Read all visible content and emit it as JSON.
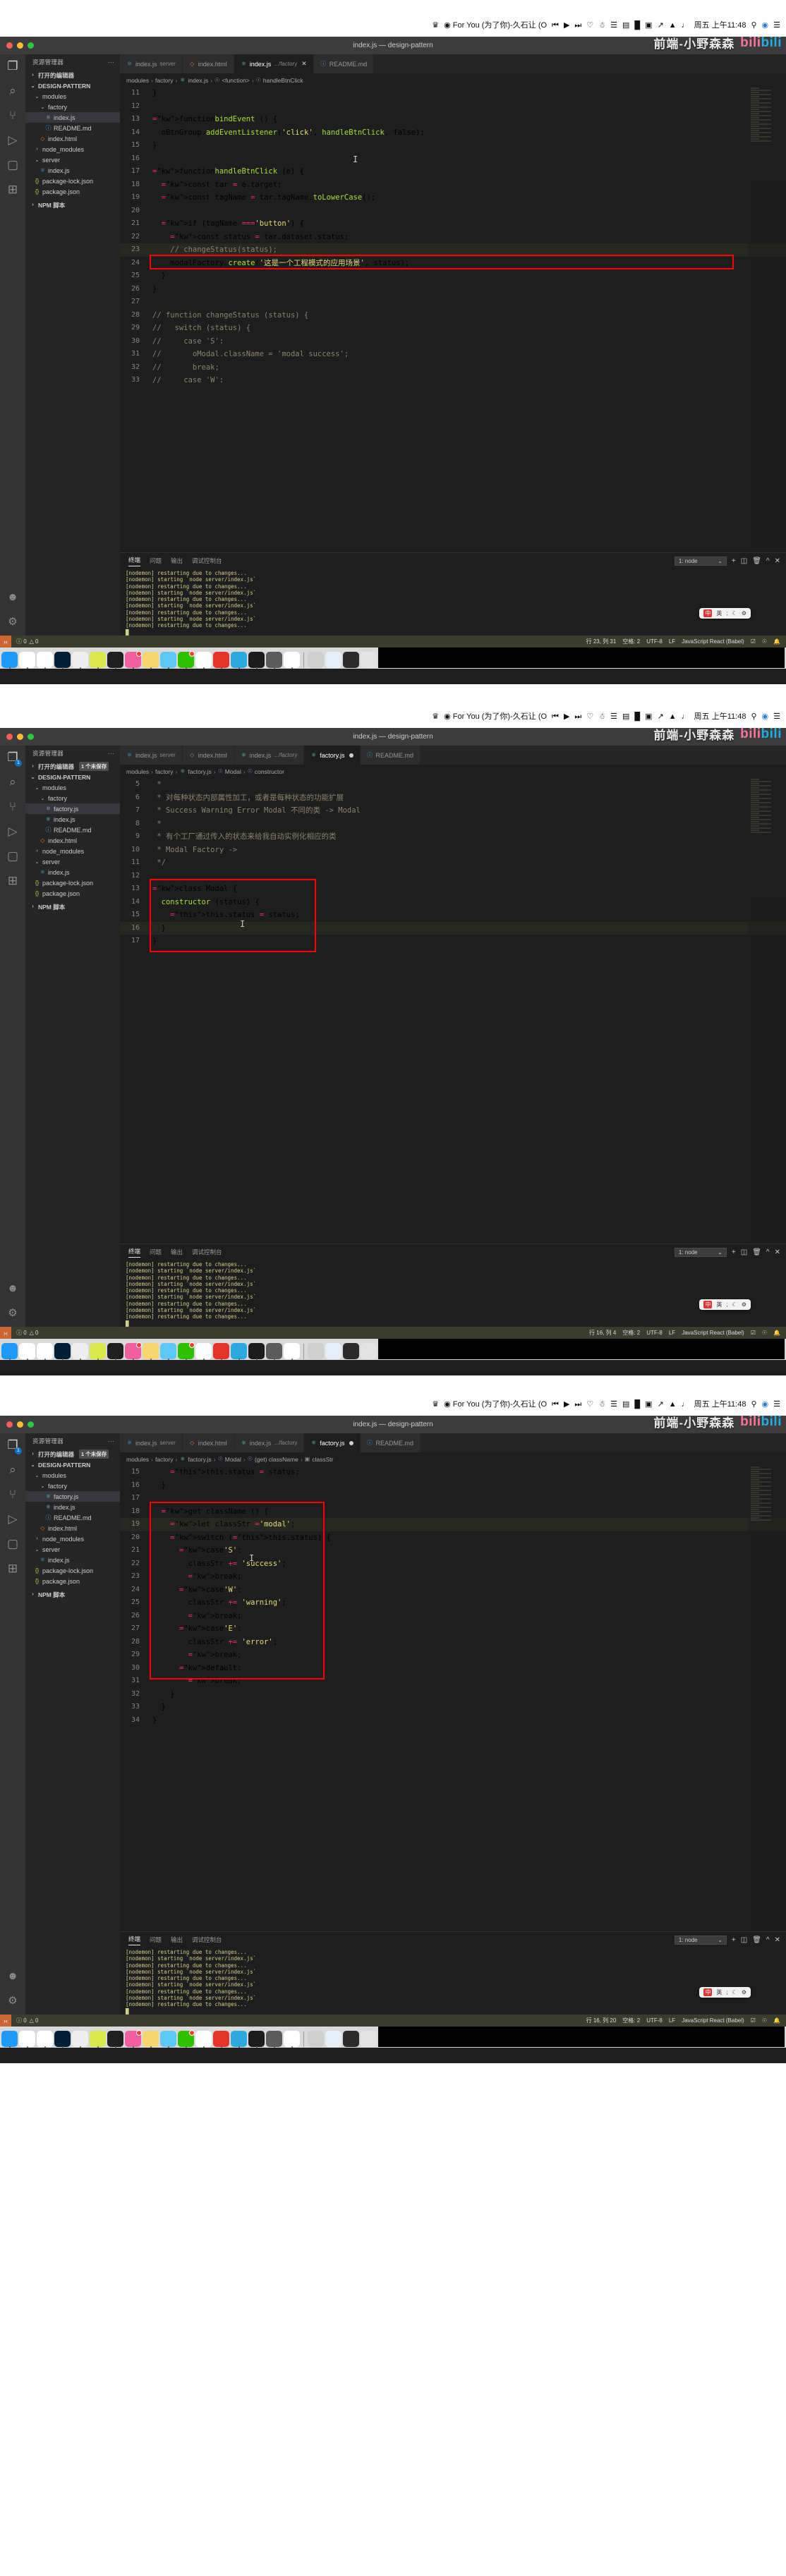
{
  "macbar": {
    "music_label": "For You (为了你)-久石让 (O",
    "time": "周五 上午11:48",
    "icons": [
      "bluetooth-icon",
      "appradio-icon",
      "prev-icon",
      "play-icon",
      "next-icon",
      "heart-icon",
      "user-icon",
      "keyboard-icon",
      "colorpicker-icon",
      "record-icon",
      "screen-icon",
      "wifi-icon",
      "battery-icon",
      "volume-icon",
      "spotlight-icon",
      "control-center-icon",
      "list-icon"
    ]
  },
  "watermark": {
    "text": "前端-小野森森",
    "brand_a": "bili",
    "brand_b": "bili"
  },
  "window": {
    "title": "index.js — design-pattern"
  },
  "activity_bar": {
    "items": [
      {
        "name": "explorer-icon",
        "glyph": "❐",
        "active": true
      },
      {
        "name": "search-icon",
        "glyph": "⌕",
        "active": false
      },
      {
        "name": "source-control-icon",
        "glyph": "⑂",
        "active": false
      },
      {
        "name": "run-debug-icon",
        "glyph": "▷",
        "active": false
      },
      {
        "name": "remote-explorer-icon",
        "glyph": "▢",
        "active": false
      },
      {
        "name": "extensions-icon",
        "glyph": "⊞",
        "active": false
      }
    ],
    "bottom": [
      {
        "name": "account-icon",
        "glyph": "☻"
      },
      {
        "name": "settings-gear-icon",
        "glyph": "⚙"
      }
    ]
  },
  "sidebar": {
    "title": "资源管理器",
    "more_label": "···",
    "open_editors_label": "打开的编辑器",
    "unsaved_badge": "1 个未保存",
    "project_label": "DESIGN-PATTERN",
    "npm_scripts_label": "NPM 脚本",
    "tree_shot1": [
      {
        "label": "modules",
        "type": "folder",
        "depth": 1,
        "open": true
      },
      {
        "label": "factory",
        "type": "folder",
        "depth": 2,
        "open": true
      },
      {
        "label": "index.js",
        "type": "jsx",
        "depth": 3,
        "selected": true
      },
      {
        "label": "README.md",
        "type": "md",
        "depth": 3
      },
      {
        "label": "index.html",
        "type": "html",
        "depth": 2
      },
      {
        "label": "node_modules",
        "type": "folder",
        "depth": 1,
        "open": false
      },
      {
        "label": "server",
        "type": "folder",
        "depth": 1,
        "open": true
      },
      {
        "label": "index.js",
        "type": "js",
        "depth": 2
      },
      {
        "label": "package-lock.json",
        "type": "json",
        "depth": 1
      },
      {
        "label": "package.json",
        "type": "json",
        "depth": 1
      }
    ],
    "tree_shot23": [
      {
        "label": "modules",
        "type": "folder",
        "depth": 1,
        "open": true
      },
      {
        "label": "factory",
        "type": "folder",
        "depth": 2,
        "open": true
      },
      {
        "label": "factory.js",
        "type": "jsx",
        "depth": 3,
        "selected": true
      },
      {
        "label": "index.js",
        "type": "jsx",
        "depth": 3
      },
      {
        "label": "README.md",
        "type": "md",
        "depth": 3
      },
      {
        "label": "index.html",
        "type": "html",
        "depth": 2
      },
      {
        "label": "node_modules",
        "type": "folder",
        "depth": 1,
        "open": false
      },
      {
        "label": "server",
        "type": "folder",
        "depth": 1,
        "open": true
      },
      {
        "label": "index.js",
        "type": "js",
        "depth": 2
      },
      {
        "label": "package-lock.json",
        "type": "json",
        "depth": 1
      },
      {
        "label": "package.json",
        "type": "json",
        "depth": 1
      }
    ]
  },
  "tabs_shot1": [
    {
      "label": "index.js",
      "sub": "server",
      "type": "js",
      "active": false,
      "close": false,
      "dirty": false
    },
    {
      "label": "index.html",
      "sub": "",
      "type": "html",
      "active": false,
      "close": false,
      "dirty": false
    },
    {
      "label": "index.js",
      "sub": ".../factory",
      "type": "jsx",
      "active": true,
      "close": true,
      "dirty": false
    },
    {
      "label": "README.md",
      "sub": "",
      "type": "md",
      "active": false,
      "close": false,
      "dirty": false
    }
  ],
  "tabs_shot2": [
    {
      "label": "index.js",
      "sub": "server",
      "type": "js",
      "active": false,
      "close": false,
      "dirty": false
    },
    {
      "label": "index.html",
      "sub": "",
      "type": "html",
      "active": false,
      "close": false,
      "dirty": false
    },
    {
      "label": "index.js",
      "sub": ".../factory",
      "type": "jsx",
      "active": false,
      "close": false,
      "dirty": false
    },
    {
      "label": "factory.js",
      "sub": "",
      "type": "jsx",
      "active": true,
      "close": false,
      "dirty": true
    },
    {
      "label": "README.md",
      "sub": "",
      "type": "md",
      "active": false,
      "close": false,
      "dirty": false
    }
  ],
  "breadcrumb_shot1": [
    "modules",
    "factory",
    "index.js",
    "<function>",
    "handleBtnClick"
  ],
  "breadcrumb_shot2": [
    "modules",
    "factory",
    "factory.js",
    "Modal",
    "constructor"
  ],
  "breadcrumb_shot3": [
    "modules",
    "factory",
    "factory.js",
    "Modal",
    "(get) className",
    "classStr"
  ],
  "code_shot1": [
    {
      "n": 11,
      "t": "}"
    },
    {
      "n": 12,
      "t": ""
    },
    {
      "n": 13,
      "t": "function bindEvent () {"
    },
    {
      "n": 14,
      "t": "  oBtnGroup.addEventListener('click', handleBtnClick, false);"
    },
    {
      "n": 15,
      "t": "}"
    },
    {
      "n": 16,
      "t": ""
    },
    {
      "n": 17,
      "t": "function handleBtnClick (e) {"
    },
    {
      "n": 18,
      "t": "  const tar = e.target;"
    },
    {
      "n": 19,
      "t": "  const tagName = tar.tagName.toLowerCase();"
    },
    {
      "n": 20,
      "t": ""
    },
    {
      "n": 21,
      "t": "  if (tagName === 'button') {"
    },
    {
      "n": 22,
      "t": "    const status = tar.dataset.status;"
    },
    {
      "n": 23,
      "t": "    // changeStatus(status);"
    },
    {
      "n": 24,
      "t": "    modalFactory.create('这是一个工程模式的应用场景', status);"
    },
    {
      "n": 25,
      "t": "  }"
    },
    {
      "n": 26,
      "t": "}"
    },
    {
      "n": 27,
      "t": ""
    },
    {
      "n": 28,
      "t": "// function changeStatus (status) {"
    },
    {
      "n": 29,
      "t": "//   switch (status) {"
    },
    {
      "n": 30,
      "t": "//     case 'S':"
    },
    {
      "n": 31,
      "t": "//       oModal.className = 'modal success';"
    },
    {
      "n": 32,
      "t": "//       break;"
    },
    {
      "n": 33,
      "t": "//     case 'W':"
    }
  ],
  "code_shot2": [
    {
      "n": 5,
      "t": " *"
    },
    {
      "n": 6,
      "t": " * 对每种状态内部属性加工，或者是每种状态的功能扩展"
    },
    {
      "n": 7,
      "t": " * Success Warning Error Modal 不同的类 -> Modal"
    },
    {
      "n": 8,
      "t": " *"
    },
    {
      "n": 9,
      "t": " * 有个工厂通过传入的状态来给我自动实例化相应的类"
    },
    {
      "n": 10,
      "t": " * Modal Factory ->"
    },
    {
      "n": 11,
      "t": " */"
    },
    {
      "n": 12,
      "t": ""
    },
    {
      "n": 13,
      "t": "class Modal {"
    },
    {
      "n": 14,
      "t": "  constructor (status) {"
    },
    {
      "n": 15,
      "t": "    this.status = status;"
    },
    {
      "n": 16,
      "t": "  }"
    },
    {
      "n": 17,
      "t": "}"
    }
  ],
  "code_shot3": [
    {
      "n": 15,
      "t": "    this.status = status;"
    },
    {
      "n": 16,
      "t": "  }"
    },
    {
      "n": 17,
      "t": ""
    },
    {
      "n": 18,
      "t": "  get className () {"
    },
    {
      "n": 19,
      "t": "    let classStr = 'modal';"
    },
    {
      "n": 20,
      "t": "    switch (this.status) {"
    },
    {
      "n": 21,
      "t": "      case 'S':"
    },
    {
      "n": 22,
      "t": "        classStr += 'success';"
    },
    {
      "n": 23,
      "t": "        break;"
    },
    {
      "n": 24,
      "t": "      case 'W':"
    },
    {
      "n": 25,
      "t": "        classStr += 'warning';"
    },
    {
      "n": 26,
      "t": "        break;"
    },
    {
      "n": 27,
      "t": "      case 'E':"
    },
    {
      "n": 28,
      "t": "        classStr += 'error';"
    },
    {
      "n": 29,
      "t": "        break;"
    },
    {
      "n": 30,
      "t": "      default:"
    },
    {
      "n": 31,
      "t": "        break;"
    },
    {
      "n": 32,
      "t": "    }"
    },
    {
      "n": 33,
      "t": "  }"
    },
    {
      "n": 34,
      "t": "}"
    }
  ],
  "panel": {
    "tabs": [
      "终端",
      "问题",
      "输出",
      "调试控制台"
    ],
    "active_tab": "终端",
    "select_value": "1: node",
    "actions": [
      "add-terminal-icon",
      "split-terminal-icon",
      "kill-terminal-icon",
      "chevron-up-icon",
      "close-panel-icon"
    ],
    "terminal_lines": [
      "[nodemon] restarting due to changes...",
      "[nodemon] starting `node server/index.js`",
      "[nodemon] restarting due to changes...",
      "[nodemon] starting `node server/index.js`",
      "[nodemon] restarting due to changes...",
      "[nodemon] starting `node server/index.js`",
      "[nodemon] restarting due to changes...",
      "[nodemon] starting `node server/index.js`",
      "[nodemon] restarting due to changes..."
    ]
  },
  "status_shot1": {
    "errors": "0",
    "warnings": "0",
    "position": "行 23, 列 31",
    "spaces": "空格: 2",
    "encoding": "UTF-8",
    "eol": "LF",
    "language": "JavaScript React (Babel)",
    "bell": "bell-icon"
  },
  "status_shot2": {
    "errors": "0",
    "warnings": "0",
    "position": "行 16, 列 4",
    "spaces": "空格: 2",
    "encoding": "UTF-8",
    "eol": "LF",
    "language": "JavaScript React (Babel)",
    "bell": "bell-icon"
  },
  "status_shot3": {
    "errors": "0",
    "warnings": "0",
    "position": "行 16, 列 20",
    "spaces": "空格: 2",
    "encoding": "UTF-8",
    "eol": "LF",
    "language": "JavaScript React (Babel)",
    "bell": "bell-icon"
  },
  "ime": {
    "mode_icon": "ime-cn-icon",
    "lang": "英",
    "punct": ";",
    "moon": "☾",
    "gear": "⚙"
  },
  "dock": {
    "icons": [
      {
        "name": "finder-icon",
        "color": "#1e9bfa"
      },
      {
        "name": "atom-icon",
        "color": "#ffffff"
      },
      {
        "name": "hbuilder-icon",
        "color": "#ffffff"
      },
      {
        "name": "photoshop-icon",
        "color": "#001e36"
      },
      {
        "name": "emoji-icon",
        "color": "#eeeeee"
      },
      {
        "name": "sublime-icon",
        "color": "#d9e84a"
      },
      {
        "name": "obs-icon",
        "color": "#1f1f1f"
      },
      {
        "name": "photos-icon",
        "color": "#f25fa0"
      },
      {
        "name": "notes-icon",
        "color": "#f5d76e"
      },
      {
        "name": "sketch-icon",
        "color": "#5bc8f5"
      },
      {
        "name": "wechat-icon",
        "color": "#2dc100"
      },
      {
        "name": "chrome-icon",
        "color": "#ffffff"
      },
      {
        "name": "thunder-icon",
        "color": "#e63329"
      },
      {
        "name": "vscode-insiders-icon",
        "color": "#2aa8e0"
      },
      {
        "name": "terminal-icon",
        "color": "#1c1c1c"
      },
      {
        "name": "settings-icon",
        "color": "#5b5b5b"
      },
      {
        "name": "vscode-icon",
        "color": "#ffffff"
      }
    ],
    "right_items": [
      {
        "name": "documents-stack-icon",
        "color": "#cfcfcf"
      },
      {
        "name": "spreadsheet-icon",
        "color": "#e6eef7"
      },
      {
        "name": "downloads-icon",
        "color": "#2b2b2b"
      },
      {
        "name": "trash-icon",
        "color": "#e3e3e3"
      }
    ]
  }
}
